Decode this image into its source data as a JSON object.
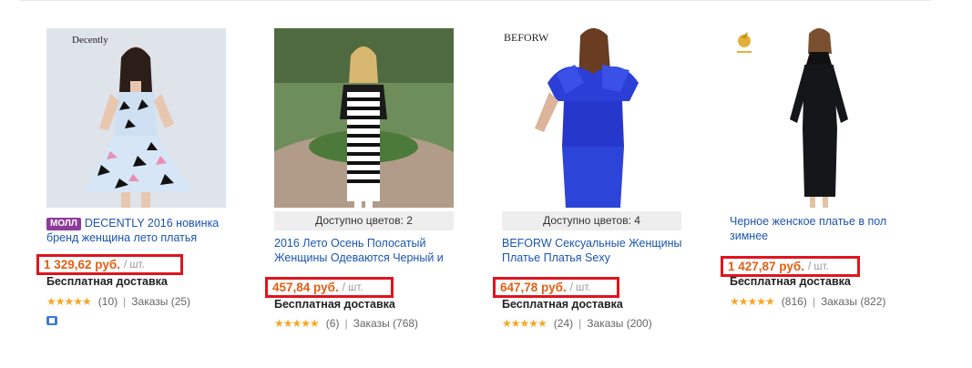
{
  "products": [
    {
      "brand_text": "Decently",
      "badge": "МОЛЛ",
      "title": "DECENTLY 2016 новинка бренд женщина лето платья",
      "price": "1 329,62 руб.",
      "unit": "/ шт.",
      "shipping": "Бесплатная доставка",
      "rating_count": "(10)",
      "orders": "Заказы (25)"
    },
    {
      "colors_label": "Доступно цветов: 2",
      "title": "2016 Лето Осень Полосатый Женщины Одеваются Черный и",
      "price": "457,84 руб.",
      "unit": "/ шт.",
      "shipping": "Бесплатная доставка",
      "rating_count": "(6)",
      "orders": "Заказы (768)"
    },
    {
      "brand_text": "BEFORW",
      "colors_label": "Доступно цветов: 4",
      "title": "BEFORW Сексуальные Женщины Платье Платья Sexy",
      "price": "647,78 руб.",
      "unit": "/ шт.",
      "shipping": "Бесплатная доставка",
      "rating_count": "(24)",
      "orders": "Заказы (200)"
    },
    {
      "title": "Черное женское платье в пол зимнее",
      "price": "1 427,87 руб.",
      "unit": "/ шт.",
      "shipping": "Бесплатная доставка",
      "rating_count": "(816)",
      "orders": "Заказы (822)"
    }
  ],
  "stars": "★★★★★",
  "colors": {
    "link": "#1a55b0",
    "price": "#e06015",
    "highlight_box": "#e0141e",
    "star": "#f5a623",
    "badge": "#8e3a9a"
  }
}
